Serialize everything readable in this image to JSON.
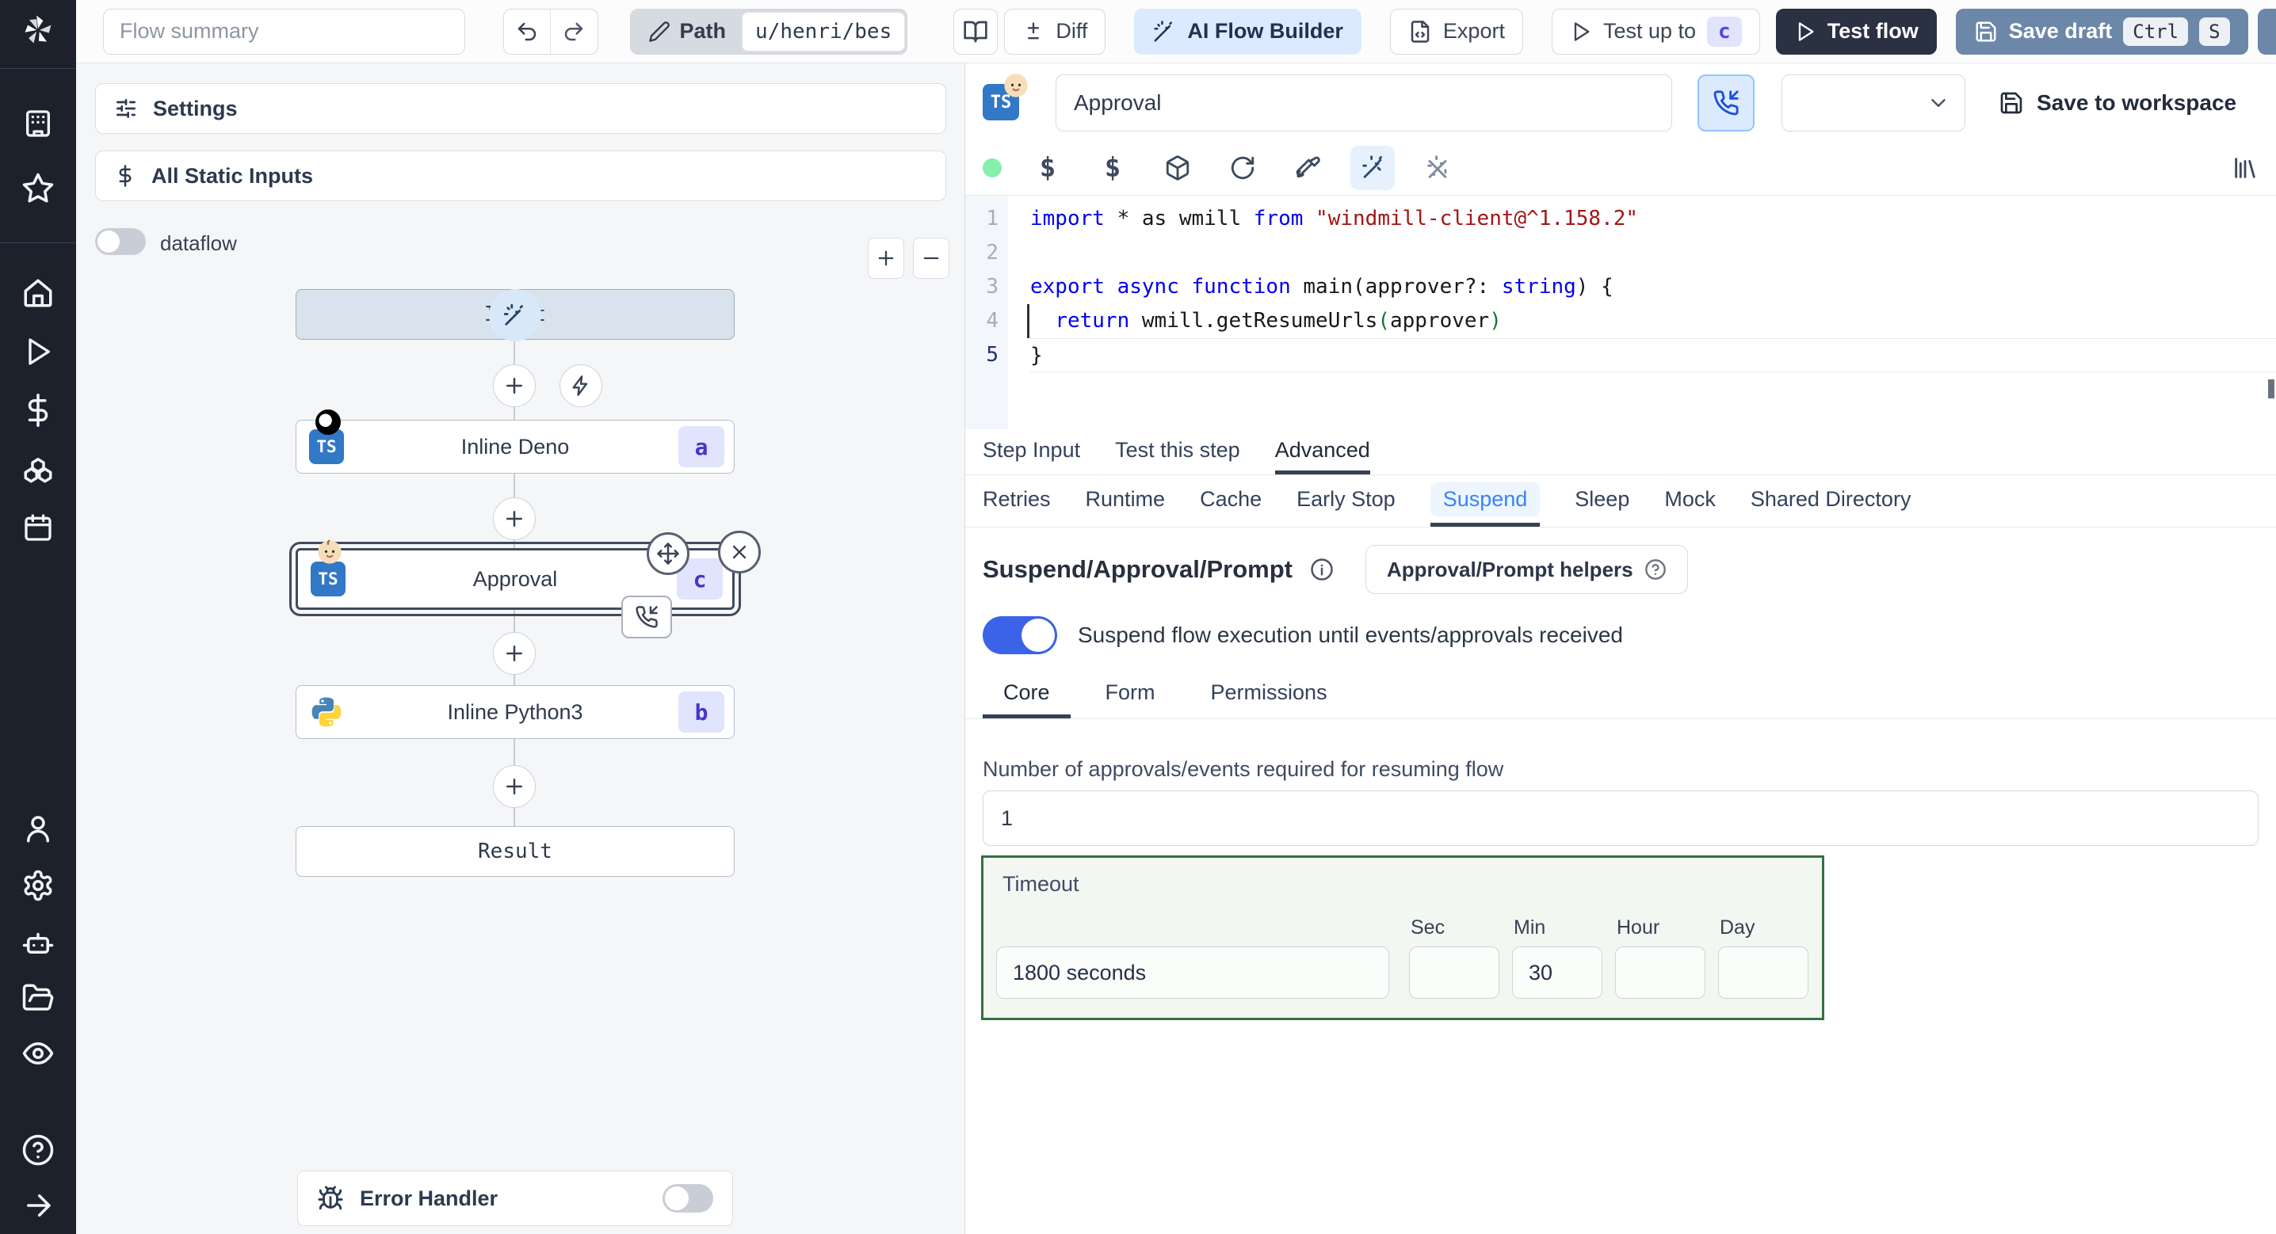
{
  "topbar": {
    "flow_summary_placeholder": "Flow summary",
    "path_label": "Path",
    "path_value": "u/henri/bes",
    "diff": "Diff",
    "ai_flow_builder": "AI Flow Builder",
    "export": "Export",
    "test_up_to": "Test up to",
    "test_up_to_badge": "c",
    "test_flow": "Test flow",
    "save_draft": "Save draft",
    "kbd_ctrl": "Ctrl",
    "kbd_s": "S"
  },
  "sidebar": {
    "icons": [
      "windmill-logo",
      "building",
      "star",
      "home",
      "play",
      "dollar",
      "cubes",
      "calendar",
      "user",
      "gear",
      "robot",
      "folder-open",
      "eye",
      "help-circle",
      "arrow-right"
    ]
  },
  "left_panel": {
    "settings": "Settings",
    "all_static_inputs": "All Static Inputs",
    "dataflow": "dataflow",
    "error_handler": "Error Handler",
    "nodes": {
      "input_label": "Input",
      "deno_label": "Inline Deno",
      "deno_badge": "a",
      "approval_label": "Approval",
      "approval_badge": "c",
      "python_label": "Inline Python3",
      "python_badge": "b",
      "result_label": "Result"
    }
  },
  "step_header": {
    "name_value": "Approval",
    "save_to_workspace": "Save to workspace"
  },
  "editor": {
    "active_line": 5,
    "lines": [
      [
        {
          "t": "import",
          "c": "kw"
        },
        {
          "t": " * as wmill ",
          "c": "d"
        },
        {
          "t": "from",
          "c": "kw"
        },
        {
          "t": " ",
          "c": "d"
        },
        {
          "t": "\"windmill-client@^1.158.2\"",
          "c": "str"
        }
      ],
      [],
      [
        {
          "t": "export",
          "c": "kw"
        },
        {
          "t": " ",
          "c": "d"
        },
        {
          "t": "async",
          "c": "kw"
        },
        {
          "t": " ",
          "c": "d"
        },
        {
          "t": "function",
          "c": "kw"
        },
        {
          "t": " main(approver?: ",
          "c": "d"
        },
        {
          "t": "string",
          "c": "kw"
        },
        {
          "t": ") {",
          "c": "d"
        }
      ],
      [
        {
          "t": "  ",
          "c": "d"
        },
        {
          "t": "return",
          "c": "kw"
        },
        {
          "t": " wmill.getResumeUrls",
          "c": "d"
        },
        {
          "t": "(",
          "c": "par"
        },
        {
          "t": "approver",
          "c": "d"
        },
        {
          "t": ")",
          "c": "par"
        }
      ],
      [
        {
          "t": "}",
          "c": "d"
        }
      ]
    ]
  },
  "tabs": {
    "main": [
      "Step Input",
      "Test this step",
      "Advanced"
    ],
    "main_active": "Advanced",
    "advanced": [
      "Retries",
      "Runtime",
      "Cache",
      "Early Stop",
      "Suspend",
      "Sleep",
      "Mock",
      "Shared Directory"
    ],
    "advanced_active": "Suspend"
  },
  "suspend": {
    "title": "Suspend/Approval/Prompt",
    "helpers_button": "Approval/Prompt helpers",
    "toggle_label": "Suspend flow execution until events/approvals received",
    "toggle_on": true,
    "tabs": [
      "Core",
      "Form",
      "Permissions"
    ],
    "tabs_active": "Core",
    "approvals_label": "Number of approvals/events required for resuming flow",
    "approvals_value": "1",
    "timeout": {
      "label": "Timeout",
      "summary_value": "1800 seconds",
      "units": [
        "Sec",
        "Min",
        "Hour",
        "Day"
      ],
      "sec_value": "",
      "min_value": "30",
      "hour_value": "",
      "day_value": ""
    }
  },
  "colors": {
    "sidebar_bg": "#1c212c",
    "accent_blue": "#3b82f6",
    "toggle_on_blue": "#3b63e8",
    "ai_button_bg": "#dbeafe",
    "save_draft_bg": "#6d87a8",
    "test_flow_bg": "#2a3143",
    "badge_bg": "#e0e4fc",
    "badge_text": "#4f46e5",
    "timeout_border_green": "#35713f",
    "timeout_bg_green": "#f2f7f2",
    "status_dot_green": "#86efac",
    "keyword_blue": "#0000ee",
    "string_red": "#a31515"
  }
}
